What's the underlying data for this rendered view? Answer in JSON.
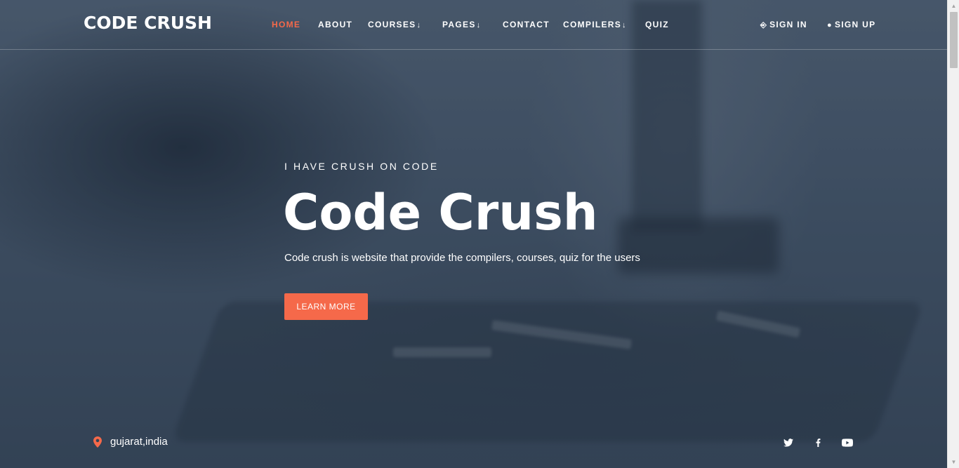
{
  "brand": {
    "logo": "CODE CRUSH",
    "accent_color": "#f5694a"
  },
  "nav": {
    "items": [
      {
        "label": "HOME",
        "active": true,
        "dropdown": false
      },
      {
        "label": "ABOUT",
        "dropdown": false
      },
      {
        "label": "COURSES",
        "dropdown": true
      },
      {
        "label": "PAGES",
        "dropdown": true
      },
      {
        "label": "CONTACT",
        "dropdown": false
      },
      {
        "label": "COMPILERS",
        "dropdown": true
      },
      {
        "label": "QUIZ",
        "dropdown": false
      }
    ],
    "dropdown_icon": "arrow-down-icon",
    "sign_in": {
      "label": "SIGN IN",
      "icon": "login-icon"
    },
    "sign_up": {
      "label": "SIGN UP",
      "icon": "user-icon"
    }
  },
  "hero": {
    "tagline": "I HAVE CRUSH ON CODE",
    "title": "Code Crush",
    "description": "Code crush is website that provide the compilers, courses, quiz for the users",
    "button_label": "LEARN MORE"
  },
  "footer": {
    "location": "gujarat,india",
    "location_icon": "map-pin-icon",
    "social": [
      "twitter-icon",
      "facebook-icon",
      "youtube-icon"
    ]
  }
}
